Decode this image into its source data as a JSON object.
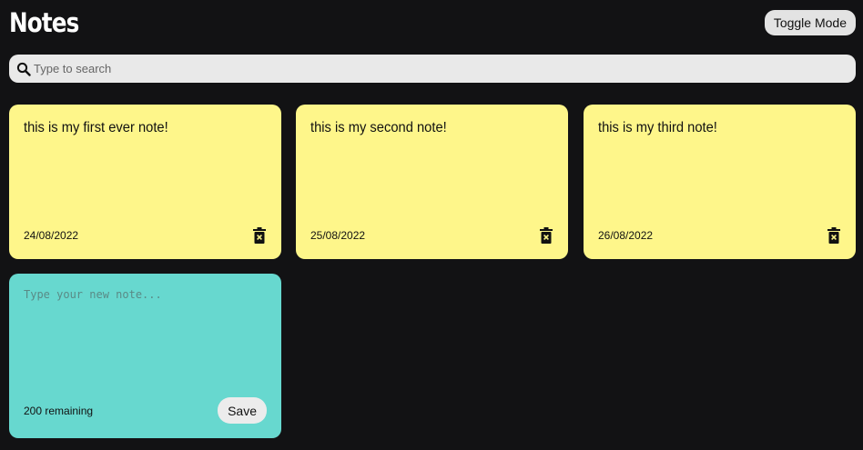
{
  "header": {
    "title": "Notes",
    "toggle_label": "Toggle Mode"
  },
  "search": {
    "placeholder": "Type to search",
    "icon": "search-icon"
  },
  "notes": [
    {
      "text": "this is my first ever note!",
      "date": "24/08/2022"
    },
    {
      "text": "this is my second note!",
      "date": "25/08/2022"
    },
    {
      "text": "this is my third note!",
      "date": "26/08/2022"
    }
  ],
  "new_note": {
    "placeholder": "Type your new note...",
    "remaining": "200 remaining",
    "save_label": "Save"
  },
  "colors": {
    "background": "#121214",
    "note": "#fef68a",
    "new_note": "#67d8cf",
    "button": "#e3e3e3"
  }
}
